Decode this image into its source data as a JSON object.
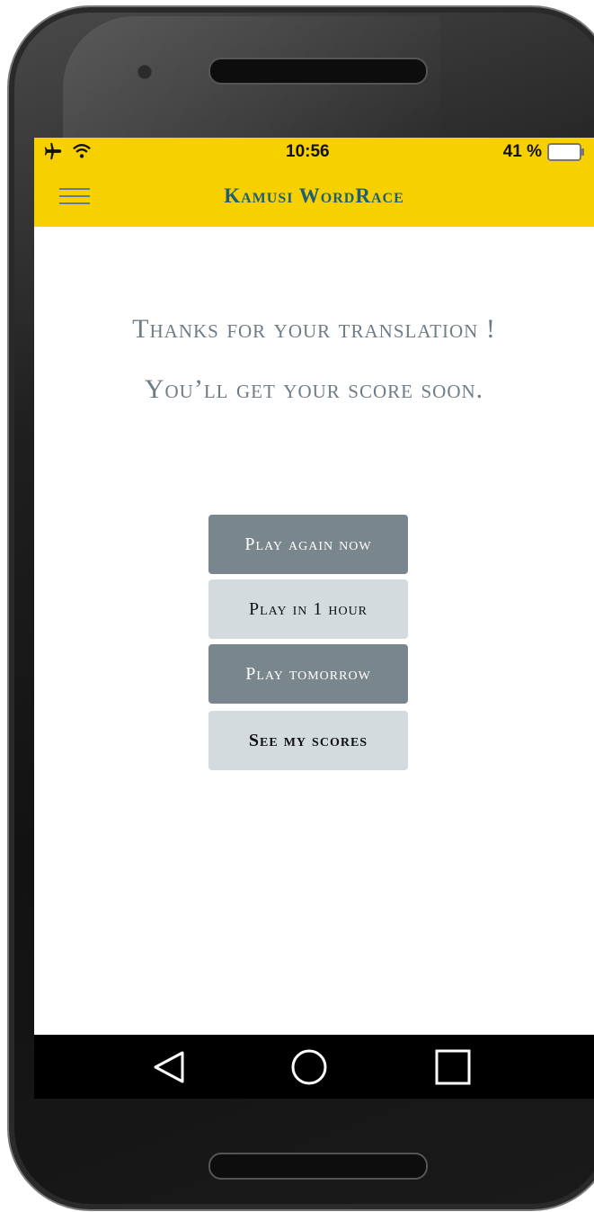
{
  "status_bar": {
    "time": "10:56",
    "battery_percent": "41 %",
    "icons": [
      "airplane-mode-icon",
      "wifi-icon",
      "battery-icon"
    ]
  },
  "app_bar": {
    "title": "Kamusi WordRace",
    "menu_icon": "hamburger-menu-icon"
  },
  "message": {
    "line1": "Thanks for your translation !",
    "line2": "You’ll get your score soon."
  },
  "buttons": {
    "play_again_now": "Play again now",
    "play_in_1_hour": "Play in 1 hour",
    "play_tomorrow": "Play tomorrow",
    "see_my_scores": "See my scores"
  },
  "nav_bar": {
    "icons": [
      "back-icon",
      "home-icon",
      "recent-apps-icon"
    ]
  },
  "colors": {
    "app_bar": "#f7d000",
    "title": "#1f5e76",
    "message_text": "#6f7c86",
    "button_dark": "#7a868d",
    "button_light": "#d3dbdf"
  }
}
